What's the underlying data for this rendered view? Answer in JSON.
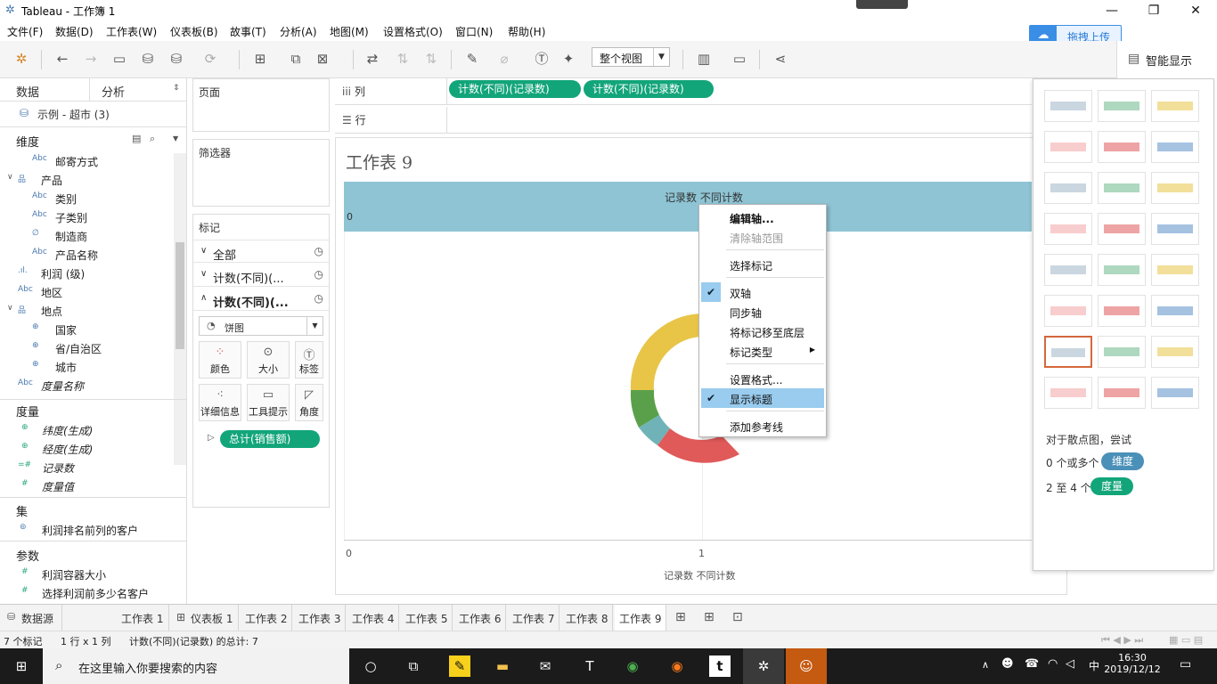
{
  "window": {
    "title": "Tableau - 工作簿 1",
    "min": "—",
    "max": "❐",
    "close": "✕"
  },
  "menu": [
    "文件(F)",
    "数据(D)",
    "工作表(W)",
    "仪表板(B)",
    "故事(T)",
    "分析(A)",
    "地图(M)",
    "设置格式(O)",
    "窗口(N)",
    "帮助(H)"
  ],
  "upload_button": "拖拽上传",
  "toolbar": {
    "view_select": "整个视图",
    "showme_label": "智能显示"
  },
  "data_pane": {
    "tab_data": "数据",
    "tab_analysis": "分析",
    "datasource": "示例 - 超市 (3)",
    "dimensions_title": "维度",
    "dimensions": [
      {
        "icon": "Abc",
        "label": "邮寄方式",
        "indent": 1
      },
      {
        "icon": "品",
        "label": "产品",
        "indent": 0
      },
      {
        "icon": "Abc",
        "label": "类别",
        "indent": 1
      },
      {
        "icon": "Abc",
        "label": "子类别",
        "indent": 1
      },
      {
        "icon": "∅",
        "label": "制造商",
        "indent": 1
      },
      {
        "icon": "Abc",
        "label": "产品名称",
        "indent": 1
      },
      {
        "icon": ".ıl.",
        "label": "利润 (级)",
        "indent": 0
      },
      {
        "icon": "Abc",
        "label": "地区",
        "indent": 0
      },
      {
        "icon": "品",
        "label": "地点",
        "indent": 0
      },
      {
        "icon": "⊕",
        "label": "国家",
        "indent": 1
      },
      {
        "icon": "⊕",
        "label": "省/自治区",
        "indent": 1
      },
      {
        "icon": "⊕",
        "label": "城市",
        "indent": 1
      },
      {
        "icon": "Abc",
        "label": "度量名称",
        "indent": 0
      }
    ],
    "measures_title": "度量",
    "measures": [
      "纬度(生成)",
      "经度(生成)",
      "记录数",
      "度量值"
    ],
    "sets_title": "集",
    "sets": [
      "利润排名前列的客户"
    ],
    "params_title": "参数",
    "params": [
      "利润容器大小",
      "选择利润前多少名客户"
    ]
  },
  "pages_title": "页面",
  "filters_title": "筛选器",
  "marks": {
    "title": "标记",
    "rows": [
      "全部",
      "计数(不同)(...",
      "计数(不同)(..."
    ],
    "type": "饼图",
    "buttons": [
      "颜色",
      "大小",
      "标签",
      "详细信息",
      "工具提示",
      "角度"
    ],
    "pill": "总计(销售额)"
  },
  "columns": {
    "label": "列",
    "pills": [
      "计数(不同)(记录数)",
      "计数(不同)(记录数)"
    ]
  },
  "rows_shelf": {
    "label": "行"
  },
  "sheet": {
    "title": "工作表 9",
    "top_axis_title": "记录数 不同计数",
    "top_axis_zero": "0",
    "bottom_axis_ticks": [
      "0",
      "1"
    ],
    "bottom_axis_title": "记录数 不同计数"
  },
  "context_menu": [
    {
      "label": "编辑轴...",
      "bold": true
    },
    {
      "label": "清除轴范围",
      "disabled": true
    },
    {
      "label": "选择标记"
    },
    {
      "label": "双轴",
      "checked": true
    },
    {
      "label": "同步轴"
    },
    {
      "label": "将标记移至底层"
    },
    {
      "label": "标记类型",
      "submenu": true
    },
    {
      "label": "设置格式..."
    },
    {
      "label": "显示标题",
      "checked": true,
      "highlighted": true
    },
    {
      "label": "添加参考线"
    }
  ],
  "showme": {
    "hint": "对于散点图，尝试",
    "req1_prefix": "0 个或多个",
    "req1_pill": "维度",
    "req2_prefix": "2 至 4 个",
    "req2_pill": "度量"
  },
  "tabs": [
    "数据源",
    "工作表 1",
    "仪表板 1",
    "工作表 2",
    "工作表 3",
    "工作表 4",
    "工作表 5",
    "工作表 6",
    "工作表 7",
    "工作表 8",
    "工作表 9"
  ],
  "status": {
    "marks": "7 个标记",
    "rowscols": "1 行 x 1 列",
    "sum": "计数(不同)(记录数) 的总计: 7"
  },
  "taskbar": {
    "search_placeholder": "在这里输入你要搜索的内容",
    "time": "16:30",
    "date": "2019/12/12",
    "ime": "中"
  },
  "colors": {
    "accent_green": "#13a57a",
    "axis_band": "#8ec4d4",
    "menu_highlight": "#99ccee",
    "donut": [
      "#e8c547",
      "#5aa04a",
      "#6fb3b8",
      "#e05a5a"
    ]
  }
}
